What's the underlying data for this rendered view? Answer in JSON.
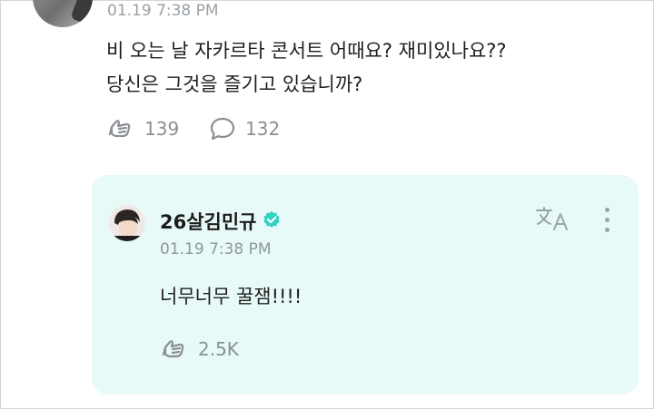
{
  "fan_post": {
    "timestamp": "01.19 7:38 PM",
    "text_line1": "비 오는 날 자카르타 콘서트 어때요? 재미있나요??",
    "text_line2": "당신은 그것을 즐기고 있습니까?",
    "like_count": "139",
    "comment_count": "132",
    "like_icon": "heart-hands-icon",
    "comment_icon": "speech-bubble-icon"
  },
  "artist_reply": {
    "author": "26살김민규",
    "verified_icon": "verified-badge-icon",
    "timestamp": "01.19 7:38 PM",
    "text": "너무너무 꿀잼!!!!",
    "like_count": "2.5K",
    "translate_icon": "translate-icon",
    "more_icon": "more-vertical-icon"
  },
  "colors": {
    "reply_background": "#e8faf7",
    "verified": "#2ed3c4",
    "muted_text": "#8b8f94"
  }
}
